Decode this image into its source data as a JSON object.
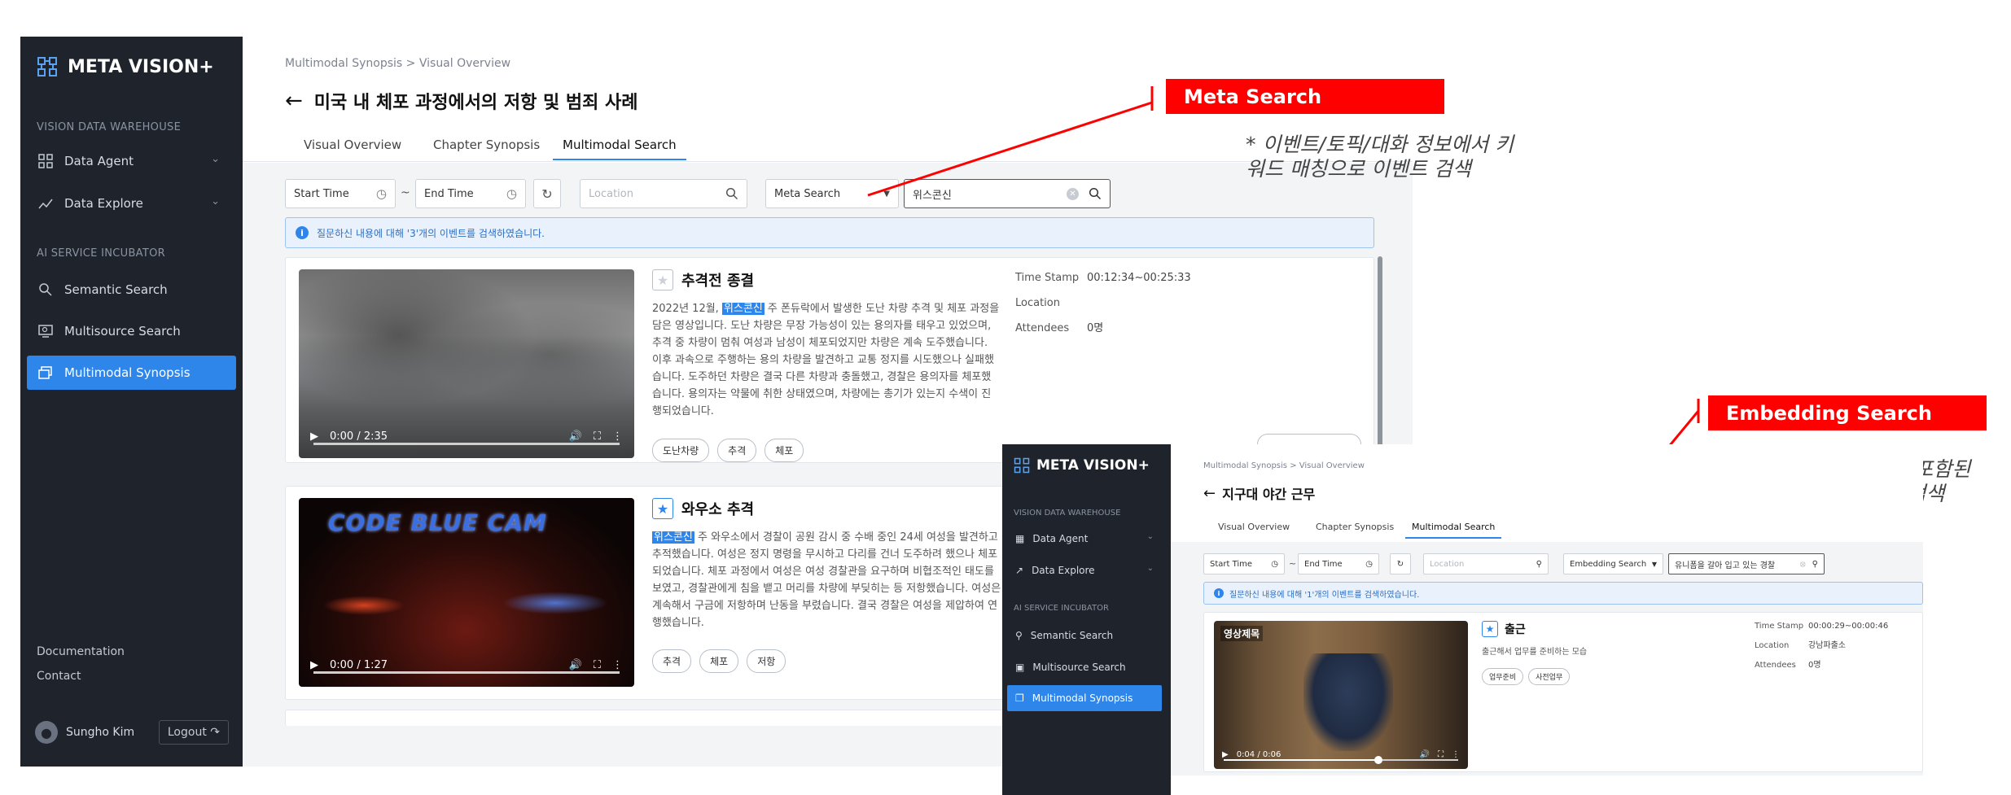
{
  "app": {
    "brand": "META VISION+",
    "sections": {
      "warehouse": "VISION DATA WAREHOUSE",
      "incubator": "AI SERVICE INCUBATOR"
    },
    "nav": {
      "data_agent": "Data Agent",
      "data_explore": "Data Explore",
      "semantic_search": "Semantic Search",
      "multisource_search": "Multisource Search",
      "multimodal_synopsis": "Multimodal Synopsis"
    },
    "footer": {
      "documentation": "Documentation",
      "contact": "Contact"
    },
    "user": {
      "name": "Sungho Kim",
      "logout": "Logout"
    }
  },
  "main": {
    "breadcrumb": {
      "parent": "Multimodal Synopsis",
      "current": "Visual Overview"
    },
    "title": "미국 내 체포 과정에서의 저항 및 범죄 사례",
    "tabs": [
      "Visual Overview",
      "Chapter Synopsis",
      "Multimodal Search"
    ],
    "filters": {
      "start_time": "Start Time",
      "end_time": "End Time",
      "tilde": "~",
      "location_placeholder": "Location",
      "search_mode": "Meta Search",
      "query": "위스콘신"
    },
    "info": "질문하신 내용에 대해 '3'개의 이벤트를 검색하였습니다.",
    "results": [
      {
        "title": "추격전 종결",
        "starred": false,
        "highlight": "위스콘신",
        "desc_before": "2022년 12월, ",
        "desc_after": " 주 폰듀락에서 발생한 도난 차량 추격 및 체포 과정을 담은 영상입니다. 도난 차량은 무장 가능성이 있는 용의자를 태우고 있었으며, 추격 중 차량이 멈춰 여성과 남성이 체포되었지만 차량은 계속 도주했습니다. 이후 과속으로 주행하는 용의 차량을 발견하고 교통 정지를 시도했으나 실패했습니다. 도주하던 차량은 결국 다른 차량과 충돌했고, 경찰은 용의자를 체포했습니다. 용의자는 약물에 취한 상태였으며, 차량에는 총기가 있는지 수색이 진행되었습니다.",
        "tags": [
          "도난차량",
          "추격",
          "체포"
        ],
        "time": "0:00 / 2:35",
        "meta": {
          "timestamp_label": "Time Stamp",
          "timestamp": "00:12:34~00:25:33",
          "location_label": "Location",
          "location": "",
          "attendees_label": "Attendees",
          "attendees": "0명"
        }
      },
      {
        "title": "와우소 추격",
        "starred": true,
        "highlight": "위스콘신",
        "desc_before": "",
        "desc_after": " 주 와우소에서 경찰이 공원 감시 중 수배 중인 24세 여성을 발견하고 추적했습니다. 여성은 정지 명령을 무시하고 다리를 건너 도주하려 했으나 체포되었습니다. 체포 과정에서 여성은 여성 경찰관을 요구하며 비협조적인 태도를 보였고, 경찰관에게 침을 뱉고 머리를 차량에 부딪히는 등 저항했습니다. 여성은 계속해서 구금에 저항하며 난동을 부렸습니다. 결국 경찰은 여성을 제압하여 연행했습니다.",
        "tags": [
          "추격",
          "체포",
          "저항"
        ],
        "time": "0:00 / 1:27",
        "overlay_text": "CODE BLUE CAM"
      }
    ]
  },
  "callouts": {
    "meta": {
      "label": "Meta Search",
      "note_line1": "* 이벤트/토픽/대화 정보에서 키",
      "note_line2": "워드 매칭으로 이벤트 검색"
    },
    "embedding": {
      "label": "Embedding Search",
      "note_line1": "* 묘사한 장면이 포함된",
      "note_line2": "이벤트(비디오) 검색"
    },
    "color": "#ff0000"
  },
  "second": {
    "brand": "META VISION+",
    "sections": {
      "warehouse": "VISION DATA WAREHOUSE",
      "incubator": "AI SERVICE INCUBATOR"
    },
    "nav": {
      "data_agent": "Data Agent",
      "data_explore": "Data Explore",
      "semantic_search": "Semantic Search",
      "multisource_search": "Multisource Search",
      "multimodal_synopsis": "Multimodal Synopsis"
    },
    "breadcrumb": {
      "parent": "Multimodal Synopsis",
      "current": "Visual Overview"
    },
    "title": "지구대 야간 근무",
    "tabs": [
      "Visual Overview",
      "Chapter Synopsis",
      "Multimodal Search"
    ],
    "filters": {
      "start_time": "Start Time",
      "end_time": "End Time",
      "tilde": "~",
      "location_placeholder": "Location",
      "search_mode": "Embedding Search",
      "query": "유니폼을 갈아 입고 있는 경찰"
    },
    "info": "질문하신 내용에 대해 '1'개의 이벤트를 검색하였습니다.",
    "result": {
      "title": "출근",
      "desc": "출근해서 업무를 준비하는 모습",
      "tags": [
        "업무준비",
        "사전업무"
      ],
      "time": "0:04 / 0:06",
      "progress": 0.66,
      "overlay_text": "영상제목",
      "meta": {
        "timestamp_label": "Time Stamp",
        "timestamp": "00:00:29~00:00:46",
        "location_label": "Location",
        "location": "강남파출소",
        "attendees_label": "Attendees",
        "attendees": "0명"
      }
    }
  },
  "colors": {
    "accent": "#2f86ea",
    "sidebar": "#1f242c",
    "highlight": "#ff0000"
  }
}
